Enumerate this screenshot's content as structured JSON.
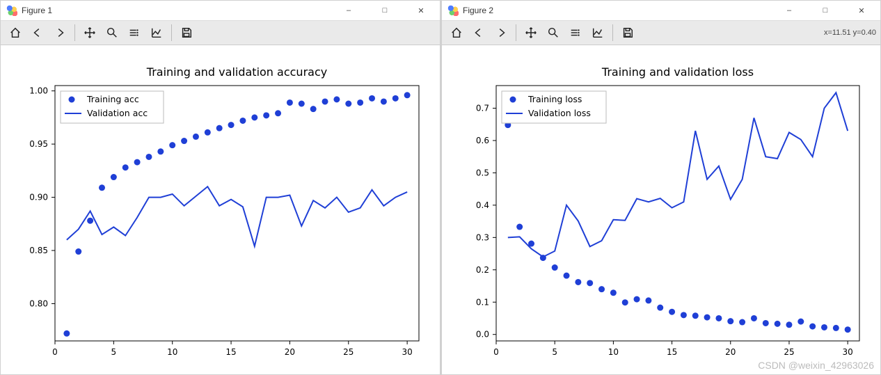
{
  "windows": [
    {
      "title": "Figure 1",
      "coord": ""
    },
    {
      "title": "Figure 2",
      "coord": "x=11.51 y=0.40"
    }
  ],
  "watermark": "CSDN @weixin_42963026",
  "chart_data": [
    {
      "type": "scatter+line",
      "title": "Training and validation accuracy",
      "xlabel": "",
      "ylabel": "",
      "xlim": [
        0,
        31
      ],
      "ylim": [
        0.765,
        1.005
      ],
      "xticks": [
        0,
        5,
        10,
        15,
        20,
        25,
        30
      ],
      "yticks": [
        0.8,
        0.85,
        0.9,
        0.95,
        1.0
      ],
      "x": [
        1,
        2,
        3,
        4,
        5,
        6,
        7,
        8,
        9,
        10,
        11,
        12,
        13,
        14,
        15,
        16,
        17,
        18,
        19,
        20,
        21,
        22,
        23,
        24,
        25,
        26,
        27,
        28,
        29,
        30
      ],
      "series": [
        {
          "name": "Training acc",
          "style": "points",
          "values": [
            0.772,
            0.849,
            0.878,
            0.909,
            0.919,
            0.928,
            0.933,
            0.938,
            0.943,
            0.949,
            0.953,
            0.957,
            0.961,
            0.965,
            0.968,
            0.972,
            0.975,
            0.977,
            0.979,
            0.989,
            0.988,
            0.983,
            0.99,
            0.992,
            0.988,
            0.989,
            0.993,
            0.99,
            0.993,
            0.996
          ]
        },
        {
          "name": "Validation acc",
          "style": "line",
          "values": [
            0.86,
            0.87,
            0.887,
            0.865,
            0.872,
            0.864,
            0.881,
            0.9,
            0.9,
            0.903,
            0.892,
            0.901,
            0.91,
            0.892,
            0.898,
            0.891,
            0.854,
            0.9,
            0.9,
            0.902,
            0.873,
            0.897,
            0.89,
            0.9,
            0.886,
            0.89,
            0.907,
            0.892,
            0.9,
            0.905
          ]
        }
      ],
      "legend": {
        "loc": "upper-left"
      }
    },
    {
      "type": "scatter+line",
      "title": "Training and validation loss",
      "xlabel": "",
      "ylabel": "",
      "xlim": [
        0,
        31
      ],
      "ylim": [
        -0.02,
        0.77
      ],
      "xticks": [
        0,
        5,
        10,
        15,
        20,
        25,
        30
      ],
      "yticks": [
        0.0,
        0.1,
        0.2,
        0.3,
        0.4,
        0.5,
        0.6,
        0.7
      ],
      "x": [
        1,
        2,
        3,
        4,
        5,
        6,
        7,
        8,
        9,
        10,
        11,
        12,
        13,
        14,
        15,
        16,
        17,
        18,
        19,
        20,
        21,
        22,
        23,
        24,
        25,
        26,
        27,
        28,
        29,
        30
      ],
      "series": [
        {
          "name": "Training loss",
          "style": "points",
          "values": [
            0.648,
            0.333,
            0.281,
            0.237,
            0.207,
            0.182,
            0.162,
            0.159,
            0.14,
            0.129,
            0.099,
            0.109,
            0.105,
            0.083,
            0.07,
            0.06,
            0.058,
            0.053,
            0.05,
            0.041,
            0.038,
            0.05,
            0.035,
            0.033,
            0.03,
            0.04,
            0.025,
            0.022,
            0.02,
            0.015
          ]
        },
        {
          "name": "Validation loss",
          "style": "line",
          "values": [
            0.3,
            0.302,
            0.265,
            0.24,
            0.258,
            0.4,
            0.351,
            0.272,
            0.29,
            0.355,
            0.353,
            0.42,
            0.41,
            0.421,
            0.392,
            0.41,
            0.63,
            0.48,
            0.521,
            0.418,
            0.48,
            0.67,
            0.55,
            0.544,
            0.625,
            0.603,
            0.55,
            0.7,
            0.748,
            0.63
          ]
        }
      ],
      "legend": {
        "loc": "upper-left"
      }
    }
  ]
}
